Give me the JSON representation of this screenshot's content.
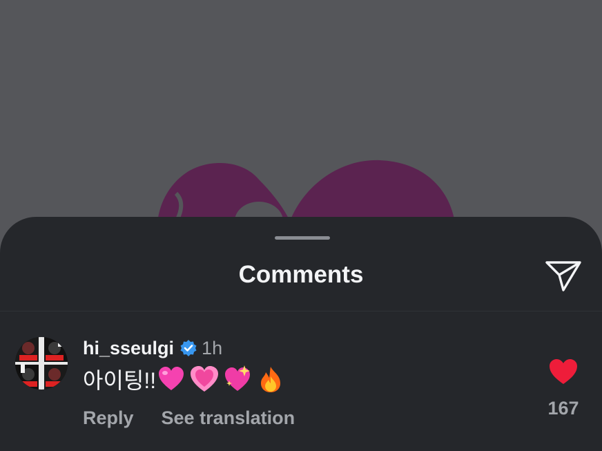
{
  "sheet": {
    "title": "Comments"
  },
  "comment": {
    "username": "hi_sseulgi",
    "verified": true,
    "time": "1h",
    "text": "아이팅!!",
    "emojis": [
      "pink-heart",
      "growing-heart",
      "sparkling-heart",
      "fire"
    ],
    "reply_label": "Reply",
    "translation_label": "See translation",
    "like_count": "167",
    "liked": true
  },
  "icons": {
    "share": "paper-plane-icon",
    "like": "heart-icon",
    "verified": "verified-badge-icon"
  },
  "colors": {
    "sheet_background": "#25272b",
    "backdrop": "#55565a",
    "like_red": "#ee1d3a",
    "verified_blue": "#3897f0",
    "primary_text": "#f3f4f6",
    "secondary_text": "#a3a6ab"
  }
}
